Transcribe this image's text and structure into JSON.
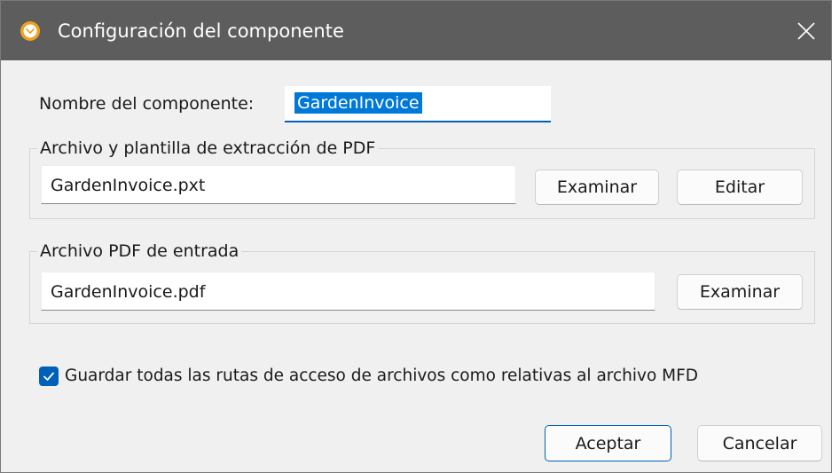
{
  "window": {
    "title": "Configuración del componente",
    "accent_color": "#005fb8",
    "titlebar_color": "#5d5d5d"
  },
  "name_row": {
    "label": "Nombre del componente:",
    "value": "GardenInvoice"
  },
  "extraction_group": {
    "legend": "Archivo y plantilla de extracción de PDF",
    "file_value": "GardenInvoice.pxt",
    "browse_label": "Examinar",
    "edit_label": "Editar"
  },
  "input_group": {
    "legend": "Archivo PDF de entrada",
    "file_value": "GardenInvoice.pdf",
    "browse_label": "Examinar"
  },
  "relative_paths": {
    "label": "Guardar todas las rutas de acceso de archivos como relativas al archivo MFD",
    "checked": true
  },
  "footer": {
    "ok_label": "Aceptar",
    "cancel_label": "Cancelar"
  },
  "icons": {
    "app": "mapforce-logo-icon",
    "close": "close-icon",
    "check": "checkmark-icon"
  }
}
